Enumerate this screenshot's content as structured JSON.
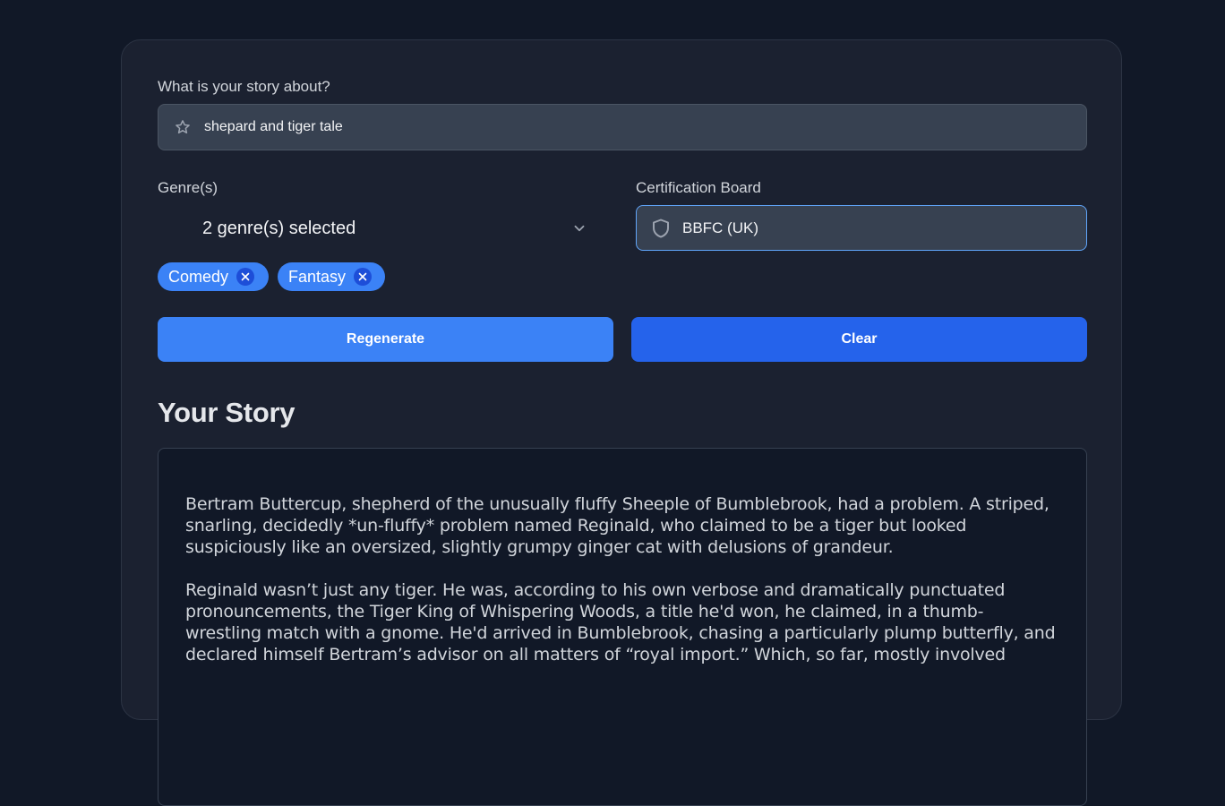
{
  "form": {
    "topic_label": "What is your story about?",
    "topic_value": "shepard and tiger tale",
    "genre_label": "Genre(s)",
    "genre_summary": "2 genre(s) selected",
    "genres": [
      "Comedy",
      "Fantasy"
    ],
    "cert_label": "Certification Board",
    "cert_value": "BBFC (UK)"
  },
  "actions": {
    "regenerate_label": "Regenerate",
    "clear_label": "Clear"
  },
  "story": {
    "heading": "Your Story",
    "paragraphs": [
      "Bertram Buttercup, shepherd of the unusually fluffy Sheeple of Bumblebrook, had a problem. A striped, snarling, decidedly *un-fluffy* problem named Reginald, who claimed to be a tiger but looked suspiciously like an oversized, slightly grumpy ginger cat with delusions of grandeur.",
      "Reginald wasn’t just any tiger. He was, according to his own verbose and dramatically punctuated pronouncements, the Tiger King of Whispering Woods, a title he'd won, he claimed, in a thumb-wrestling match with a gnome. He'd arrived in Bumblebrook, chasing a particularly plump butterfly, and declared himself Bertram’s advisor on all matters of “royal import.” Which, so far, mostly involved"
    ]
  },
  "colors": {
    "background": "#111827",
    "card": "#1b2130",
    "accent": "#3b82f6",
    "accent_dark": "#2563eb",
    "focus_border": "#60a5fa"
  },
  "icons": {
    "topic": "star-icon",
    "genre_dropdown": "chevron-down-icon",
    "cert": "shield-icon",
    "chip_remove": "close-icon"
  }
}
